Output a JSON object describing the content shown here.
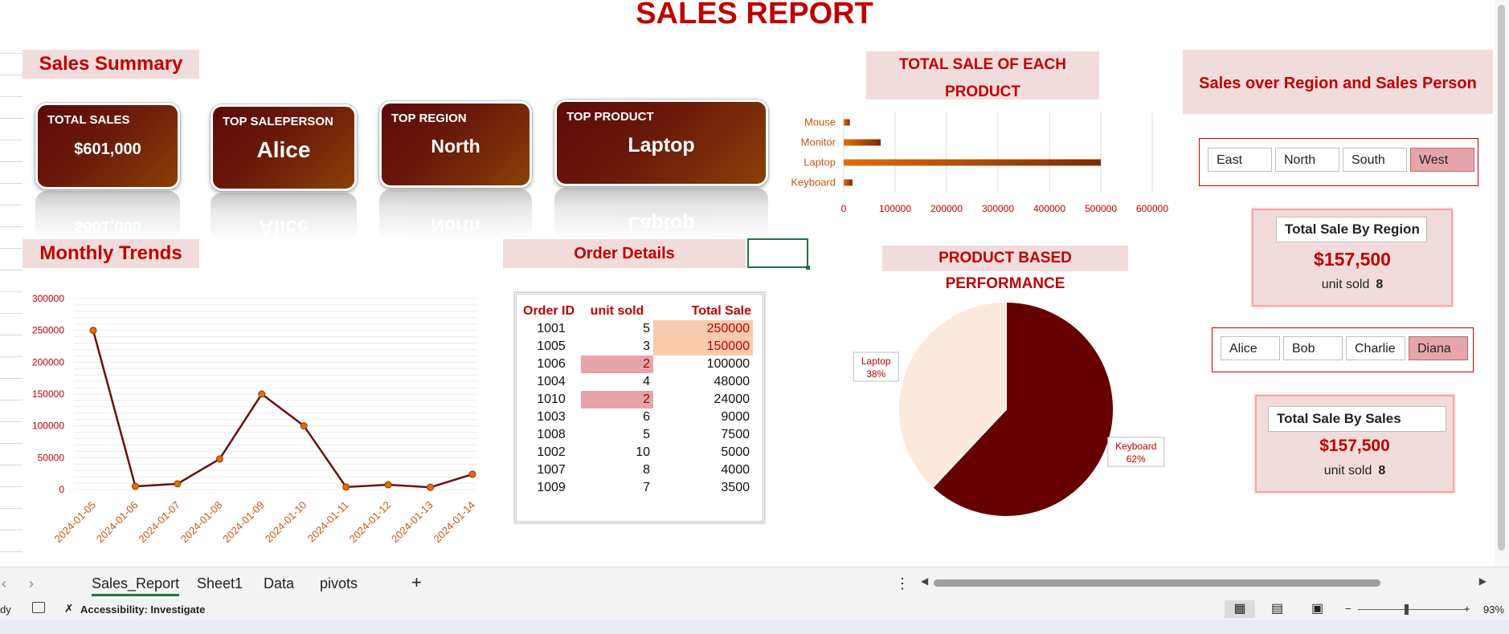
{
  "report_title": "SALES REPORT",
  "sections": {
    "sales_summary": "Sales Summary",
    "monthly_trends": "Monthly Trends",
    "order_details": "Order Details",
    "total_sale_each_product": "TOTAL SALE OF EACH PRODUCT",
    "product_performance": "PRODUCT BASED PERFORMANCE",
    "sales_region_person": "Sales over Region and Sales Person"
  },
  "kpis": [
    {
      "label": "TOTAL SALES",
      "value": "$601,000"
    },
    {
      "label": "TOP SALEPERSON",
      "value": "Alice"
    },
    {
      "label": "TOP REGION",
      "value": "North"
    },
    {
      "label": "TOP PRODUCT",
      "value": "Laptop"
    }
  ],
  "colors": {
    "accent": "#c00000",
    "kpi_dark": "#5c0a0a",
    "kpi_light": "#8a4007",
    "pink_fill": "#f2dcdb",
    "bar": "#c65911",
    "pie_dark": "#660000",
    "pie_light": "#fce9dc"
  },
  "order_table": {
    "headers": [
      "Order ID",
      "unit sold",
      "Total Sale"
    ],
    "rows": [
      {
        "id": "1001",
        "units": "5",
        "total": "250000",
        "hl_total": "orange"
      },
      {
        "id": "1005",
        "units": "3",
        "total": "150000",
        "hl_total": "orange"
      },
      {
        "id": "1006",
        "units": "2",
        "total": "100000",
        "hl_units": "red"
      },
      {
        "id": "1004",
        "units": "4",
        "total": "48000"
      },
      {
        "id": "1010",
        "units": "2",
        "total": "24000",
        "hl_units": "red"
      },
      {
        "id": "1003",
        "units": "6",
        "total": "9000"
      },
      {
        "id": "1008",
        "units": "5",
        "total": "7500"
      },
      {
        "id": "1002",
        "units": "10",
        "total": "5000"
      },
      {
        "id": "1007",
        "units": "8",
        "total": "4000"
      },
      {
        "id": "1009",
        "units": "7",
        "total": "3500"
      }
    ]
  },
  "slicers": {
    "region": {
      "items": [
        "East",
        "North",
        "South",
        "West"
      ],
      "selected": "West"
    },
    "person": {
      "items": [
        "Alice",
        "Bob",
        "Charlie",
        "Diana"
      ],
      "selected": "Diana"
    }
  },
  "region_card": {
    "title": "Total Sale By Region",
    "amount": "$157,500",
    "units_label": "unit sold",
    "units": "8"
  },
  "sales_card": {
    "title": "Total Sale By Sales",
    "amount": "$157,500",
    "units_label": "unit sold",
    "units": "8"
  },
  "chart_data": [
    {
      "type": "line",
      "x": [
        "2024-01-05",
        "2024-01-06",
        "2024-01-07",
        "2024-01-08",
        "2024-01-09",
        "2024-01-10",
        "2024-01-11",
        "2024-01-12",
        "2024-01-13",
        "2024-01-14"
      ],
      "series": [
        {
          "values": [
            250000,
            5000,
            9000,
            48000,
            150000,
            100000,
            4000,
            7500,
            3500,
            24000
          ]
        }
      ],
      "yticks": [
        "0",
        "50000",
        "100000",
        "150000",
        "200000",
        "250000",
        "300000"
      ],
      "ylim": [
        0,
        300000
      ]
    },
    {
      "type": "bar",
      "orientation": "horizontal",
      "categories": [
        "Mouse",
        "Monitor",
        "Laptop",
        "Keyboard"
      ],
      "values": [
        12000,
        72000,
        500000,
        17000
      ],
      "xticks": [
        "0",
        "100000",
        "200000",
        "300000",
        "400000",
        "500000",
        "600000"
      ],
      "xlim": [
        0,
        600000
      ]
    },
    {
      "type": "pie",
      "slices": [
        {
          "label": "Keyboard",
          "pct_label": "62%",
          "value": 62
        },
        {
          "label": "Laptop",
          "pct_label": "38%",
          "value": 38
        }
      ]
    }
  ],
  "sheet_tabs": {
    "items": [
      "Sales_Report",
      "Sheet1",
      "Data",
      "pivots"
    ],
    "active": "Sales_Report",
    "add": "+"
  },
  "status": {
    "ready": "dy",
    "accessibility": "Accessibility: Investigate",
    "zoom": "93%",
    "minus": "−",
    "plus": "+"
  }
}
